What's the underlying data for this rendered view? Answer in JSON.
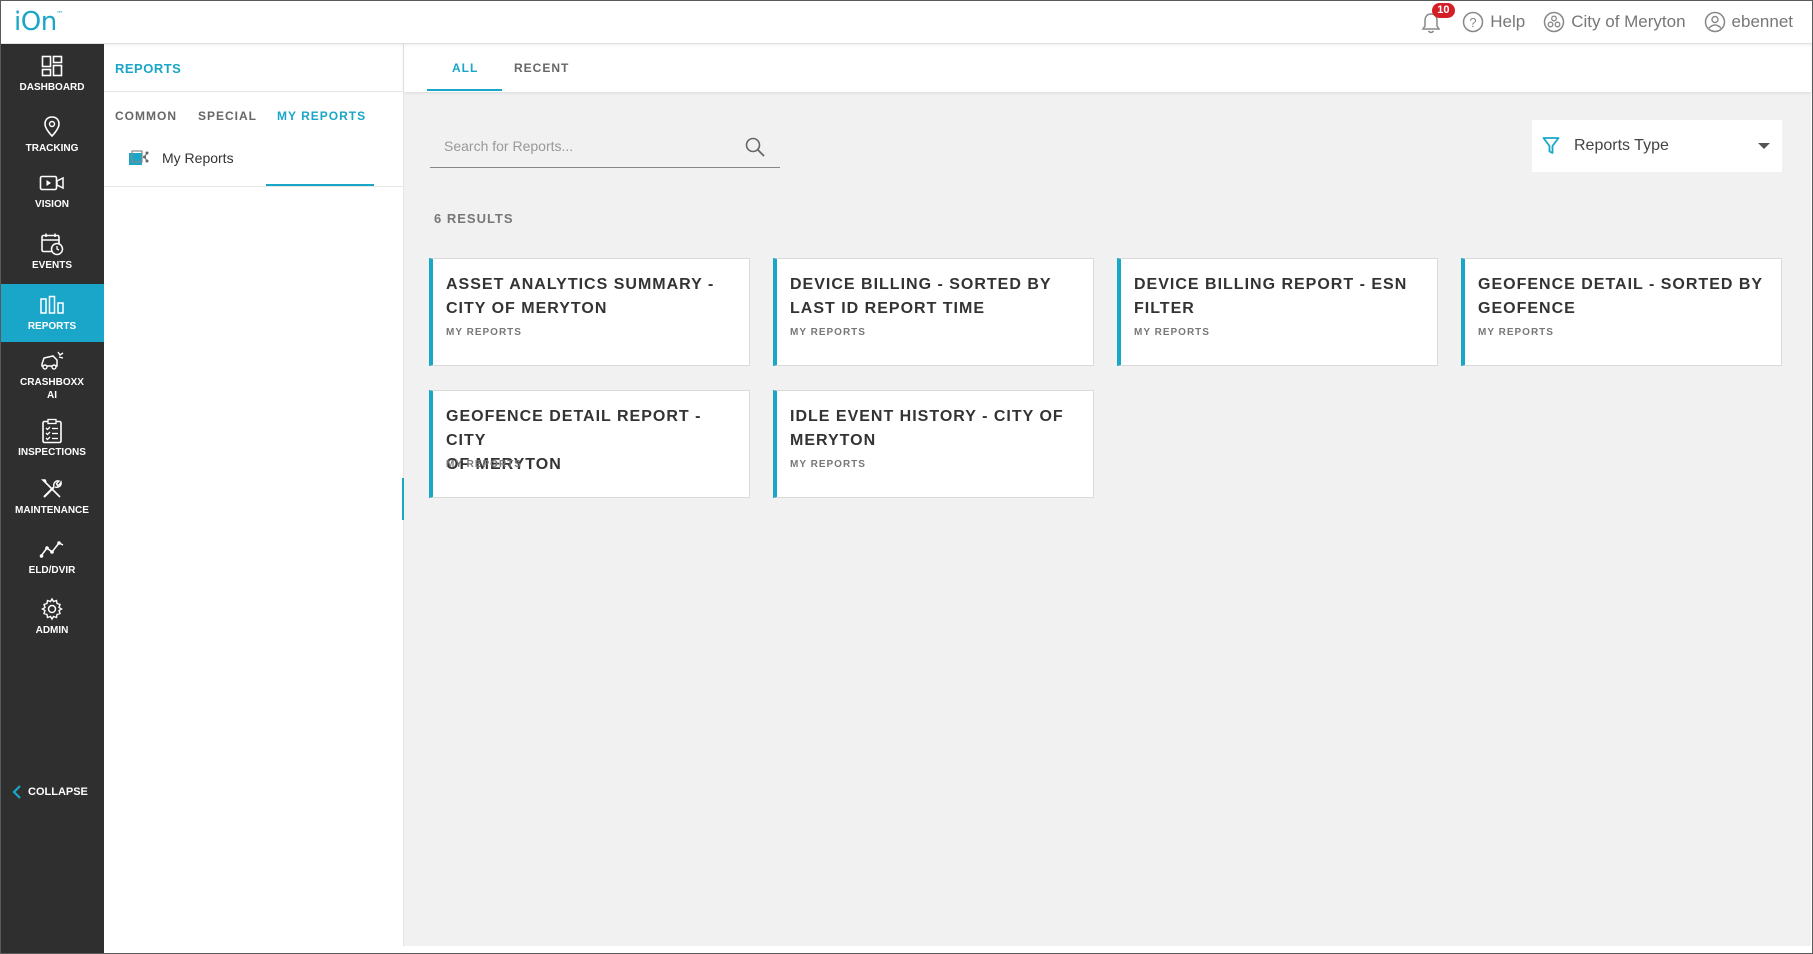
{
  "app": {
    "logo": "iOn",
    "logo_tm": "™"
  },
  "topbar": {
    "notification_count": "10",
    "help_label": "Help",
    "org_label": "City of Meryton",
    "user_label": "ebennet"
  },
  "nav": {
    "items": [
      {
        "label": "DASHBOARD",
        "icon": "dashboard-icon"
      },
      {
        "label": "TRACKING",
        "icon": "map-pin-icon"
      },
      {
        "label": "VISION",
        "icon": "video-camera-icon"
      },
      {
        "label": "EVENTS",
        "icon": "calendar-clock-icon"
      },
      {
        "label": "REPORTS",
        "icon": "bar-chart-icon"
      },
      {
        "label": "CRASHBOXX",
        "label2": "AI",
        "icon": "crash-car-icon"
      },
      {
        "label": "INSPECTIONS",
        "icon": "checklist-icon"
      },
      {
        "label": "MAINTENANCE",
        "icon": "wrench-screwdriver-icon"
      },
      {
        "label": "ELD/DVIR",
        "icon": "trend-line-icon"
      },
      {
        "label": "ADMIN",
        "icon": "gear-icon"
      }
    ],
    "collapse_label": "COLLAPSE",
    "active_color": "#1aa6c8"
  },
  "subpanel": {
    "title": "REPORTS",
    "tabs": [
      "COMMON",
      "SPECIAL",
      "MY REPORTS"
    ],
    "active_tab": "MY REPORTS",
    "tree": [
      {
        "label": "My Reports",
        "icon": "shared-folder-icon"
      }
    ]
  },
  "main": {
    "tabs": [
      "ALL",
      "RECENT"
    ],
    "active_tab": "ALL",
    "search_placeholder": "Search for Reports...",
    "filter_label": "Reports Type",
    "results_label": "6 RESULTS",
    "cards": [
      {
        "title_line1": "ASSET ANALYTICS SUMMARY -",
        "title_line2": "CITY OF MERYTON",
        "category": "MY REPORTS"
      },
      {
        "title_line1": "DEVICE BILLING - SORTED BY",
        "title_line2": "LAST ID REPORT TIME",
        "category": "MY REPORTS"
      },
      {
        "title_line1": "DEVICE BILLING REPORT - ESN",
        "title_line2": "FILTER",
        "category": "MY REPORTS"
      },
      {
        "title_line1": "GEOFENCE DETAIL - SORTED BY",
        "title_line2": "GEOFENCE",
        "category": "MY REPORTS"
      },
      {
        "title_line1": "GEOFENCE DETAIL REPORT - CITY",
        "title_line2": "OF MERYTON",
        "category": "MY REPORTS"
      },
      {
        "title_line1": "IDLE EVENT HISTORY - CITY OF",
        "title_line2": "MERYTON",
        "category": "MY REPORTS"
      }
    ]
  }
}
